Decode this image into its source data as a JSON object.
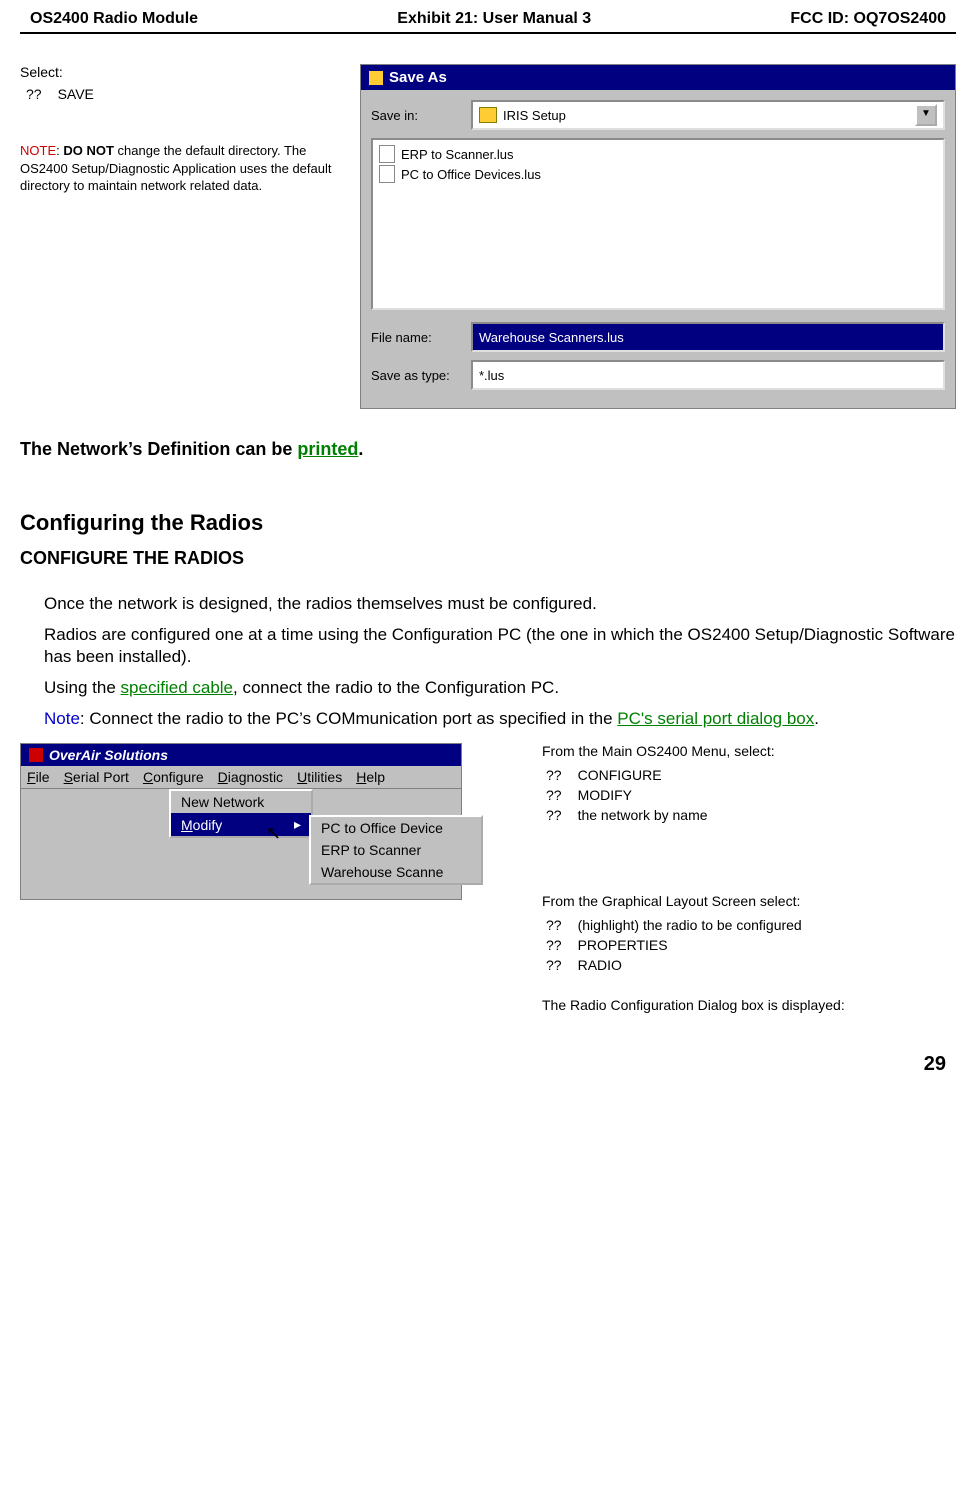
{
  "header": {
    "left": "OS2400 Radio Module",
    "center": "Exhibit 21: User Manual 3",
    "right": "FCC ID: OQ7OS2400"
  },
  "top_left": {
    "select_label": "Select:",
    "save_bullet": "??",
    "save_text": "SAVE",
    "note_label": "NOTE",
    "note_colon": ":  ",
    "note_bold": "DO NOT",
    "note_rest": " change the default directory.  The OS2400 Setup/Diagnostic Application uses the default directory to maintain network related data."
  },
  "saveas": {
    "title": "Save As",
    "save_in_label": "Save in:",
    "folder_name": "IRIS Setup",
    "files": [
      "ERP to Scanner.lus",
      "PC to Office Devices.lus"
    ],
    "file_name_label": "File name:",
    "file_name_value": "Warehouse Scanners.lus",
    "save_as_type_label": "Save as type:",
    "save_as_type_value": "*.lus"
  },
  "print_line": {
    "before": "The Network’s Definition can be ",
    "link": "printed",
    "after": "."
  },
  "sec": {
    "h1": "Configuring the Radios",
    "h2": "CONFIGURE THE RADIOS",
    "p1": "Once the network is designed, the radios themselves must be configured.",
    "p2": "Radios are configured one at a time using the Configuration PC (the one in which the OS2400 Setup/Diagnostic Software has been installed).",
    "p3a": "Using the ",
    "p3link": "specified cable",
    "p3b": ", connect the radio to the Configuration PC.",
    "p4note": "Note",
    "p4a": ":  Connect the radio to the PC’s COMmunication port as specified in the ",
    "p4link": "PC's serial port dialog box",
    "p4b": "."
  },
  "overair": {
    "title": "OverAir Solutions",
    "menu": [
      "File",
      "Serial Port",
      "Configure",
      "Diagnostic",
      "Utilities",
      "Help"
    ],
    "drop": [
      "New Network",
      "Modify"
    ],
    "submenu": [
      "PC to Office Device",
      "ERP to Scanner",
      "Warehouse Scanne"
    ]
  },
  "right1": {
    "lead": "From the Main OS2400 Menu, select:",
    "bullet": "??",
    "items": [
      "CONFIGURE",
      "MODIFY",
      "the network by name"
    ]
  },
  "right2": {
    "lead": "From the Graphical Layout Screen select:",
    "bullet": "??",
    "items": [
      "(highlight) the radio to be configured",
      "PROPERTIES",
      "RADIO"
    ],
    "final": "The Radio Configuration Dialog box is displayed:"
  },
  "page_num": "29"
}
